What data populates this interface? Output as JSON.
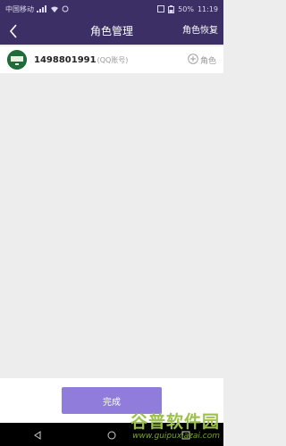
{
  "status_bar": {
    "carrier": "中国移动",
    "battery": "50%",
    "time": "11:19"
  },
  "header": {
    "back_icon": "chevron-left-icon",
    "title": "角色管理",
    "action_label": "角色恢复"
  },
  "account": {
    "number": "1498801991",
    "type_label": "(QQ账号)",
    "add_role_label": "角色",
    "add_icon": "plus-circle-icon"
  },
  "footer": {
    "done_label": "完成"
  },
  "watermark": {
    "title": "谷普软件园",
    "url": "www.guipuxiazai.com"
  },
  "colors": {
    "header_bg": "#3c2f66",
    "page_bg": "#ededed",
    "button_bg": "#8f7cdb"
  }
}
